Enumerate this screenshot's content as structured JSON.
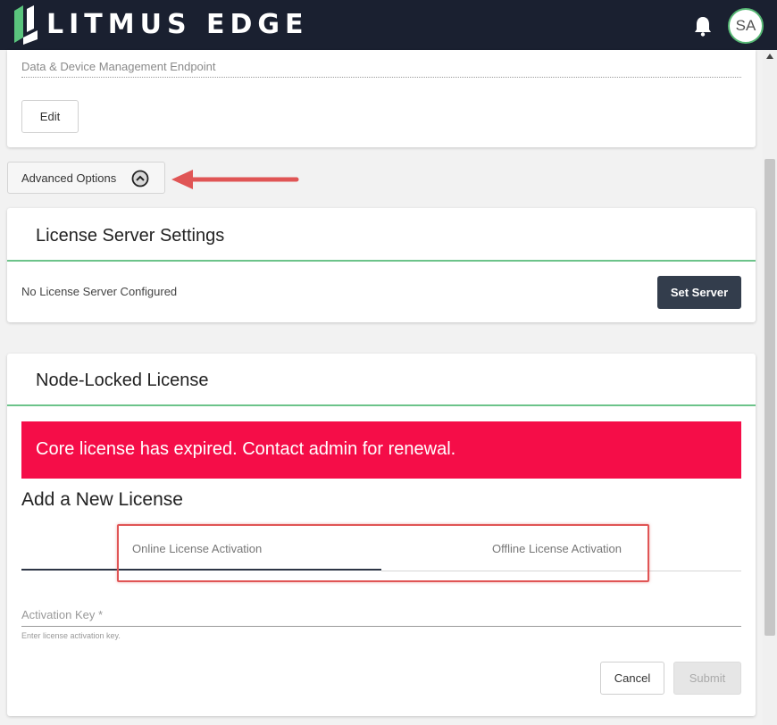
{
  "header": {
    "brand": "LITMUS EDGE",
    "avatar_initials": "SA",
    "icons": [
      "litmus-logo-icon",
      "bell-icon"
    ]
  },
  "endpoint_card": {
    "label": "Data & Device Management Endpoint",
    "edit_label": "Edit"
  },
  "advanced_options": {
    "label": "Advanced Options",
    "icon": "chevron-up-circle-icon"
  },
  "license_server": {
    "title": "License Server Settings",
    "status": "No License Server Configured",
    "set_server_label": "Set Server"
  },
  "node_locked": {
    "title": "Node-Locked License",
    "alert": "Core license has expired. Contact admin for renewal.",
    "add_title": "Add a New License",
    "tabs": [
      {
        "label": "Online License Activation",
        "active": true
      },
      {
        "label": "Offline License Activation",
        "active": false
      }
    ],
    "activation_key_label": "Activation Key *",
    "activation_key_value": "",
    "activation_key_hint": "Enter license activation key.",
    "cancel_label": "Cancel",
    "submit_label": "Submit"
  },
  "colors": {
    "header_bg": "#1a2030",
    "accent_green": "#6cc38a",
    "alert_red": "#f50d48",
    "primary_button": "#333d4c",
    "annotation_red": "#e05555"
  }
}
